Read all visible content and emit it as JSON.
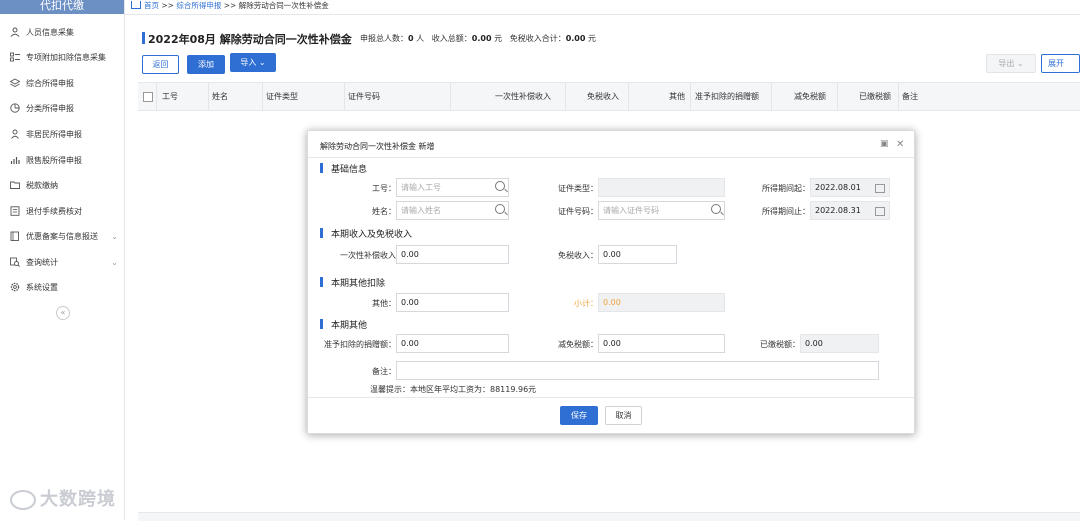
{
  "sidebar": {
    "header": "代扣代缴",
    "items": [
      {
        "label": "人员信息采集",
        "icon": "person-icon"
      },
      {
        "label": "专项附加扣除信息采集",
        "icon": "list-icon"
      },
      {
        "label": "综合所得申报",
        "icon": "layers-icon"
      },
      {
        "label": "分类所得申报",
        "icon": "pie-chart-icon"
      },
      {
        "label": "非居民所得申报",
        "icon": "person-outline-icon"
      },
      {
        "label": "限售股所得申报",
        "icon": "bar-chart-icon"
      },
      {
        "label": "税款缴纳",
        "icon": "folder-icon"
      },
      {
        "label": "退付手续费核对",
        "icon": "document-icon"
      },
      {
        "label": "优惠备案与信息报送",
        "icon": "file-icon"
      },
      {
        "label": "查询统计",
        "icon": "search-stats-icon"
      },
      {
        "label": "系统设置",
        "icon": "gear-icon"
      }
    ],
    "collapse_glyph": "«"
  },
  "breadcrumb": {
    "home": "首页",
    "sep": ">>",
    "level1": "综合所得申报",
    "current": "解除劳动合同一次性补偿金"
  },
  "page": {
    "title": "2022年08月 解除劳动合同一次性补偿金",
    "summary": {
      "count_label": "申报总人数：",
      "count_value": "0",
      "count_unit": "人",
      "income_label": "收入总额：",
      "income_value": "0.00",
      "income_unit": "元",
      "taxfree_label": "免税收入合计：",
      "taxfree_value": "0.00",
      "taxfree_unit": "元"
    }
  },
  "toolbar": {
    "back": "返回",
    "add": "添加",
    "import": "导入",
    "import_caret": "⌄",
    "export": "导出",
    "export_caret": "⌄",
    "expand": "展开"
  },
  "table": {
    "columns": [
      "工号",
      "姓名",
      "证件类型",
      "证件号码",
      "一次性补偿收入",
      "免税收入",
      "其他",
      "准予扣除的捐赠额",
      "减免税额",
      "已缴税额",
      "备注"
    ]
  },
  "watermark": "大数跨境",
  "modal": {
    "title": "解除劳动合同一次性补偿金 新增",
    "sections": {
      "basic": "基础信息",
      "income": "本期收入及免税收入",
      "deduction": "本期其他扣除",
      "other": "本期其他"
    },
    "fields": {
      "emp_no": {
        "label": "工号：",
        "placeholder": "请输入工号"
      },
      "name": {
        "label": "姓名：",
        "placeholder": "请输入姓名"
      },
      "id_type": {
        "label": "证件类型：",
        "value": ""
      },
      "id_no": {
        "label": "证件号码：",
        "placeholder": "请输入证件号码"
      },
      "period_start": {
        "label": "所得期间起：",
        "value": "2022.08.01"
      },
      "period_end": {
        "label": "所得期间止：",
        "value": "2022.08.31"
      },
      "lump_sum": {
        "label": "一次性补偿收入",
        "value": "0.00"
      },
      "taxfree": {
        "label": "免税收入：",
        "value": "0.00"
      },
      "other_ded": {
        "label": "其他：",
        "value": "0.00"
      },
      "subtotal": {
        "label": "小计：",
        "value": "0.00"
      },
      "donation": {
        "label": "准予扣除的捐赠额：",
        "value": "0.00"
      },
      "relief": {
        "label": "减免税额：",
        "value": "0.00"
      },
      "paid": {
        "label": "已缴税额：",
        "value": "0.00"
      },
      "remark": {
        "label": "备注：",
        "value": ""
      }
    },
    "tip": "温馨提示：本地区年平均工资为：88119.96元",
    "save": "保存",
    "cancel": "取消"
  },
  "colors": {
    "accent": "#2f6fd3",
    "subtotal": "#f0a23b"
  }
}
